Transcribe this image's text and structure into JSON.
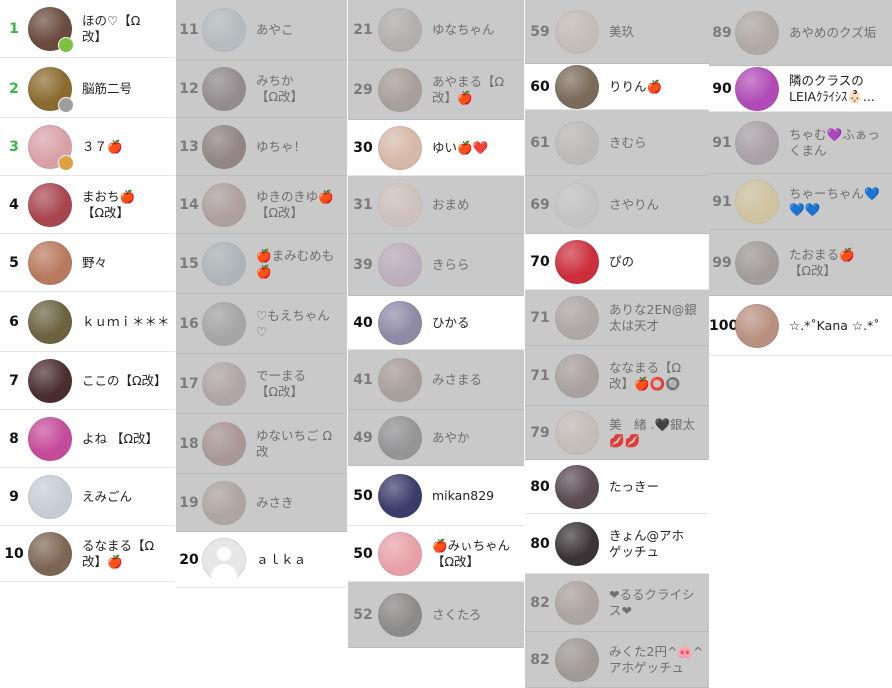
{
  "columns": [
    {
      "rows": [
        {
          "rank": "1",
          "name": "ほの♡【Ω\n改】",
          "dim": false,
          "green": true,
          "avatar": "#6a4a3e",
          "badge": {
            "icon": "crown-badge",
            "text": "",
            "color": "#7cc142"
          }
        },
        {
          "rank": "2",
          "name": "脳筋二号",
          "dim": false,
          "green": true,
          "avatar": "#8a6a2e",
          "badge": {
            "icon": "silver-badge",
            "text": "",
            "color": "#9e9e9e"
          }
        },
        {
          "rank": "3",
          "name": "３７🍎",
          "dim": false,
          "green": true,
          "avatar": "#d9a1a6",
          "badge": {
            "icon": "bronze-badge",
            "text": "",
            "color": "#e0a040"
          }
        },
        {
          "rank": "4",
          "name": "まおち🍎\n【Ω改】",
          "dim": false,
          "green": false,
          "avatar": "#a84650"
        },
        {
          "rank": "5",
          "name": "野々",
          "dim": false,
          "green": false,
          "avatar": "#b87a5e"
        },
        {
          "rank": "6",
          "name": "ｋｕｍｉ＊＊＊",
          "dim": false,
          "green": false,
          "avatar": "#6b6240"
        },
        {
          "rank": "7",
          "name": "ここの【Ω改】",
          "dim": false,
          "green": false,
          "avatar": "#4a2e2e"
        },
        {
          "rank": "8",
          "name": "よね 【Ω改】",
          "dim": false,
          "green": false,
          "avatar": "#c44a9a"
        },
        {
          "rank": "9",
          "name": "えみごん",
          "dim": false,
          "green": false,
          "avatar": "#c6ccd6"
        },
        {
          "rank": "10",
          "name": "るなまる【Ω\n改】🍎",
          "dim": false,
          "green": false,
          "avatar": "#7d6555"
        }
      ]
    },
    {
      "rows": [
        {
          "rank": "11",
          "name": "あやこ",
          "dim": true,
          "avatar": "#9fb3bf"
        },
        {
          "rank": "12",
          "name": "みちか\n【Ω改】",
          "dim": true,
          "avatar": "#6e5a62"
        },
        {
          "rank": "13",
          "name": "ゆちゃ！",
          "dim": true,
          "avatar": "#7a4a4a"
        },
        {
          "rank": "14",
          "name": "ゆきのきゆ🍎\n【Ω改】",
          "dim": true,
          "avatar": "#b07a78"
        },
        {
          "rank": "15",
          "name": "🍎まみむめも\n🍎",
          "dim": true,
          "avatar": "#8fa7b2"
        },
        {
          "rank": "16",
          "name": "♡もえちゃん\n♡",
          "dim": true,
          "avatar": "#8a8a8a"
        },
        {
          "rank": "17",
          "name": "でーまる\n【Ω改】",
          "dim": true,
          "avatar": "#a8888a"
        },
        {
          "rank": "18",
          "name": "ゆないちご Ω\n改",
          "dim": true,
          "avatar": "#a86a64"
        },
        {
          "rank": "19",
          "name": "みさき",
          "dim": true,
          "avatar": "#a3877a"
        },
        {
          "rank": "20",
          "name": "ａｌｋａ",
          "dim": false,
          "avatar": "default"
        }
      ]
    },
    {
      "rows": [
        {
          "rank": "21",
          "name": "ゆなちゃん",
          "dim": true,
          "avatar": "#a59a94"
        },
        {
          "rank": "29",
          "name": "あやまる【Ω\n改】🍎",
          "dim": true,
          "avatar": "#9a7a6e"
        },
        {
          "rank": "30",
          "name": "ゆい🍎❤️",
          "dim": false,
          "avatar": "#d6b8a8"
        },
        {
          "rank": "31",
          "name": "おまめ",
          "dim": true,
          "avatar": "#e8b8a6"
        },
        {
          "rank": "39",
          "name": "きらら",
          "dim": true,
          "avatar": "#c890c0"
        },
        {
          "rank": "40",
          "name": "ひかる",
          "dim": false,
          "avatar": "#8e8aa6"
        },
        {
          "rank": "41",
          "name": "みさまる",
          "dim": true,
          "avatar": "#9a7c6e"
        },
        {
          "rank": "49",
          "name": "あやか",
          "dim": true,
          "avatar": "#6e6a70"
        },
        {
          "rank": "50",
          "name": "mikan829",
          "dim": false,
          "avatar": "#3a3c6a"
        },
        {
          "rank": "50",
          "name": "🍎みぃちゃん\n【Ω改】",
          "dim": false,
          "avatar": "#e8a0a8"
        },
        {
          "rank": "52",
          "name": "さくたろ",
          "dim": true,
          "avatar": "#5e5a56"
        }
      ]
    },
    {
      "rows": [
        {
          "rank": "59",
          "name": "美玖",
          "dim": true,
          "avatar": "#c9b2a2"
        },
        {
          "rank": "60",
          "name": "りりん🍎",
          "dim": false,
          "avatar": "#7a6a5a"
        },
        {
          "rank": "61",
          "name": "きむら",
          "dim": true,
          "avatar": "#b4b0ab"
        },
        {
          "rank": "69",
          "name": "さやりん",
          "dim": true,
          "avatar": "#c4c0c0"
        },
        {
          "rank": "70",
          "name": "ぴの",
          "dim": false,
          "avatar": "#cc2e3c"
        },
        {
          "rank": "71",
          "name": "ありな2EN@銀\n太は天才",
          "dim": true,
          "avatar": "#a08c86"
        },
        {
          "rank": "71",
          "name": "ななまる【Ω\n改】🍎⭕🔘",
          "dim": true,
          "avatar": "#9a8078"
        },
        {
          "rank": "79",
          "name": "美　緒 .🖤銀太\n💋💋",
          "dim": true,
          "avatar": "#c8b4a4"
        },
        {
          "rank": "80",
          "name": "たっきー",
          "dim": false,
          "avatar": "#5a4a52"
        },
        {
          "rank": "80",
          "name": "きょん@アホ\nゲッチュ",
          "dim": false,
          "avatar": "#3a3436"
        },
        {
          "rank": "82",
          "name": "❤るるクライシ\nス❤",
          "dim": true,
          "avatar": "#a08478"
        },
        {
          "rank": "82",
          "name": "みくた2円^🐽^\nアホゲッチュ",
          "dim": true,
          "avatar": "#8a7268"
        }
      ]
    },
    {
      "rows": [
        {
          "rank": "89",
          "name": "あやめのクズ垢",
          "dim": true,
          "avatar": "#a49080"
        },
        {
          "rank": "90",
          "name": "隣のクラスの\nLEIAｸﾗｲｼｽ👶🏻...",
          "dim": false,
          "avatar": "#b04ab6"
        },
        {
          "rank": "91",
          "name": "ちゃむ💜ふぁっ\nくまん",
          "dim": true,
          "avatar": "#9a8090"
        },
        {
          "rank": "91",
          "name": "ちゃーちゃん💙\n💙💙",
          "dim": true,
          "avatar": "#e8c040"
        },
        {
          "rank": "99",
          "name": "たおまる🍎\n【Ω改】",
          "dim": true,
          "avatar": "#8a7872"
        },
        {
          "rank": "100",
          "name": "☆.*˚Kana ☆.*˚",
          "dim": false,
          "avatar": "#b89080"
        }
      ]
    }
  ]
}
